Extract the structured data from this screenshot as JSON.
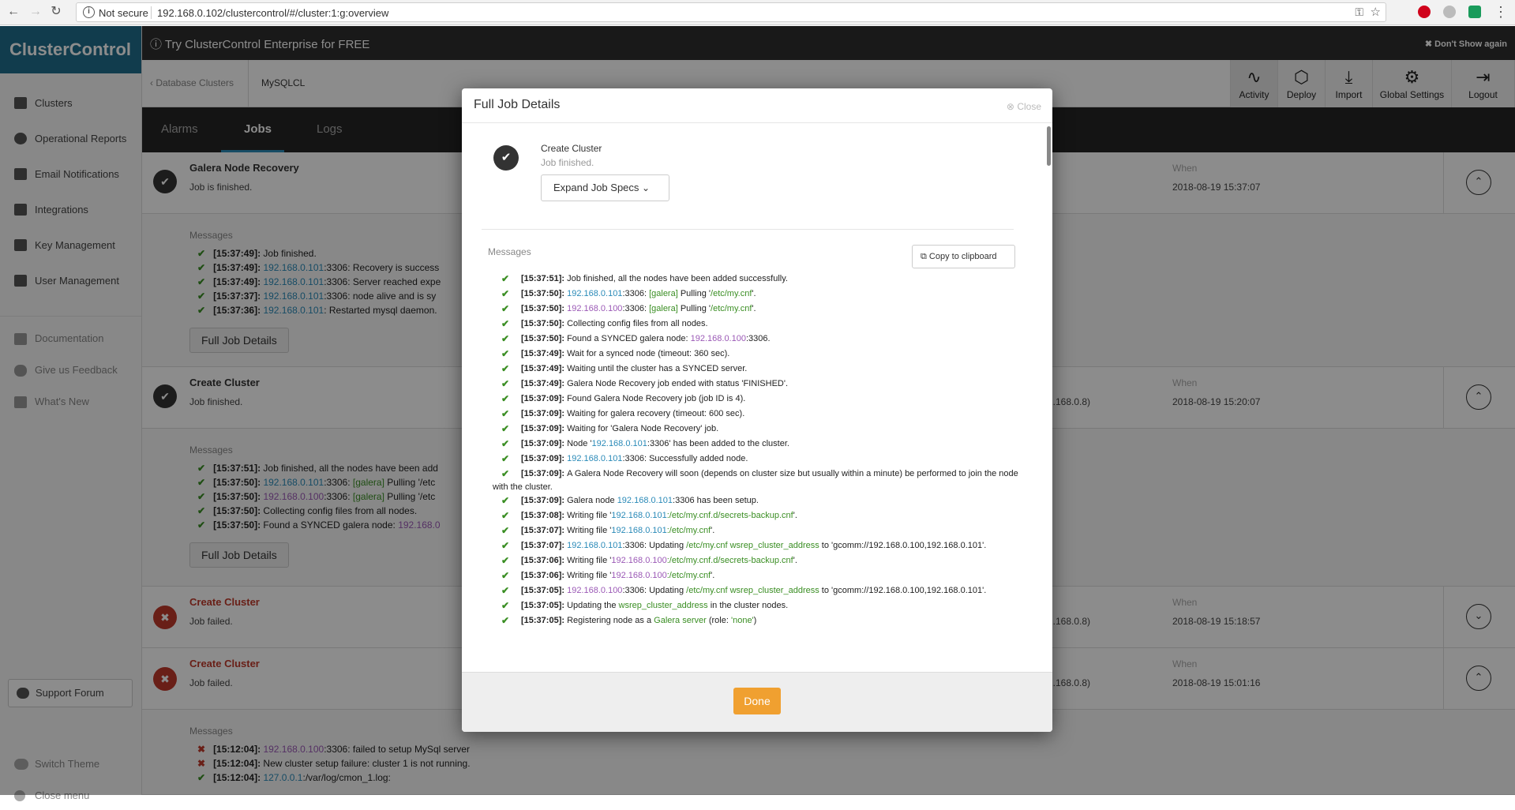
{
  "browser": {
    "not_secure": "Not secure",
    "url": "192.168.0.102/clustercontrol/#/cluster:1:g:overview"
  },
  "app": {
    "logo": "ClusterControl",
    "promo": "Try ClusterControl Enterprise for FREE",
    "dont_show": "✖ Don't Show again"
  },
  "sidebar": {
    "items": [
      {
        "label": "Clusters"
      },
      {
        "label": "Operational Reports"
      },
      {
        "label": "Email Notifications"
      },
      {
        "label": "Integrations"
      },
      {
        "label": "Key Management"
      },
      {
        "label": "User Management"
      }
    ],
    "secondary": [
      {
        "label": "Documentation"
      },
      {
        "label": "Give us Feedback"
      },
      {
        "label": "What's New"
      }
    ],
    "support_forum": "Support Forum",
    "switch_theme": "Switch Theme",
    "close_menu": "Close menu"
  },
  "breadcrumb": {
    "back": "‹ Database Clusters",
    "cluster": "MySQLCL"
  },
  "tools": [
    {
      "label": "Activity",
      "icon": "activity-icon"
    },
    {
      "label": "Deploy",
      "icon": "deploy-icon"
    },
    {
      "label": "Import",
      "icon": "import-icon"
    },
    {
      "label": "Global Settings",
      "icon": "settings-icon"
    },
    {
      "label": "Logout",
      "icon": "logout-icon"
    }
  ],
  "tabs": {
    "alarms": "Alarms",
    "jobs": "Jobs",
    "logs": "Logs"
  },
  "jobs": {
    "when_label": "When",
    "messages_label": "Messages",
    "full_job_details": "Full Job Details",
    "job1": {
      "title": "Galera Node Recovery",
      "status": "Job is finished.",
      "when": "2018-08-19 15:37:07"
    },
    "job1_msgs": [
      {
        "t": "[15:37:49]:",
        "a": " Job finished."
      },
      {
        "t": "[15:37:49]:",
        "h": "192.168.0.101",
        "a": ":3306: Recovery is success"
      },
      {
        "t": "[15:37:49]:",
        "h": "192.168.0.101",
        "a": ":3306: Server reached expe"
      },
      {
        "t": "[15:37:37]:",
        "h": "192.168.0.101",
        "a": ":3306: node alive and is sy"
      },
      {
        "t": "[15:37:36]:",
        "h": "192.168.0.101",
        "a": ": Restarted mysql daemon."
      }
    ],
    "job2": {
      "title": "Create Cluster",
      "status": "Job finished.",
      "host": "2.168.0.8)",
      "when": "2018-08-19 15:20:07"
    },
    "job2_msgs": [
      {
        "t": "[15:37:51]:",
        "a": " Job finished, all the nodes have been add"
      },
      {
        "t": "[15:37:50]:",
        "h": "192.168.0.101",
        "a": ":3306: ",
        "g": "[galera]",
        "b": " Pulling '/etc"
      },
      {
        "t": "[15:37:50]:",
        "p": "192.168.0.100",
        "a": ":3306: ",
        "g": "[galera]",
        "b": " Pulling '/etc"
      },
      {
        "t": "[15:37:50]:",
        "a": " Collecting config files from all nodes."
      },
      {
        "t": "[15:37:50]:",
        "a": " Found a SYNCED galera node: ",
        "p2": "192.168.0"
      }
    ],
    "job3": {
      "title": "Create Cluster",
      "status": "Job failed.",
      "host": "2.168.0.8)",
      "when": "2018-08-19 15:18:57"
    },
    "job4": {
      "title": "Create Cluster",
      "status": "Job failed.",
      "host": "2.168.0.8)",
      "when": "2018-08-19 15:01:16"
    },
    "job4_msgs": [
      {
        "t": "[15:12:04]:",
        "p": "192.168.0.100",
        "a": ":3306: failed to setup MySql server"
      },
      {
        "t": "[15:12:04]:",
        "a": " New cluster setup failure: cluster 1 is not running."
      },
      {
        "t": "[15:12:04]:",
        "h": "127.0.0.1",
        "a": ":/var/log/cmon_1.log:"
      }
    ]
  },
  "modal": {
    "title": "Full Job Details",
    "close": "Close",
    "job_title": "Create Cluster",
    "job_status": "Job finished.",
    "expand": "Expand Job Specs",
    "messages_label": "Messages",
    "copy": "Copy to clipboard",
    "done": "Done",
    "lines": [
      "[15:37:51]:|Job finished, all the nodes have been added successfully.",
      "[15:37:50]:|192.168.0.101|:3306: |[galera]| Pulling '|/etc/my.cnf|'.",
      "[15:37:50]:|192.168.0.100|:3306: |[galera]| Pulling '|/etc/my.cnf|'.",
      "[15:37:50]:|Collecting config files from all nodes.",
      "[15:37:50]:|Found a SYNCED galera node: |192.168.0.100|:3306.",
      "[15:37:49]:|Wait for a synced node (timeout: 360 sec).",
      "[15:37:49]:|Waiting until the cluster has a SYNCED server.",
      "[15:37:49]:|Galera Node Recovery job ended with status 'FINISHED'.",
      "[15:37:09]:|Found Galera Node Recovery job (job ID is 4).",
      "[15:37:09]:|Waiting for galera recovery (timeout: 600 sec).",
      "[15:37:09]:|Waiting for 'Galera Node Recovery' job.",
      "[15:37:09]:|Node '|192.168.0.101|:3306' has been added to the cluster.",
      "[15:37:09]:|192.168.0.101|:3306: Successfully added node.",
      "[15:37:09]:|A Galera Node Recovery will soon (depends on cluster size but usually within a minute) be performed to join the node with the cluster.",
      "[15:37:09]:|Galera node |192.168.0.101|:3306 has been setup.",
      "[15:37:08]:|Writing file '|192.168.0.101|:/etc/my.cnf.d/secrets-backup.cnf|'.",
      "[15:37:07]:|Writing file '|192.168.0.101|:/etc/my.cnf|'.",
      "[15:37:07]:|192.168.0.101|:3306: Updating |/etc/my.cnf| |wsrep_cluster_address| to 'gcomm://192.168.0.100,192.168.0.101'.",
      "[15:37:06]:|Writing file '|192.168.0.100|:/etc/my.cnf.d/secrets-backup.cnf|'.",
      "[15:37:06]:|Writing file '|192.168.0.100|:/etc/my.cnf|'.",
      "[15:37:05]:|192.168.0.100|:3306: Updating |/etc/my.cnf| |wsrep_cluster_address| to 'gcomm://192.168.0.100,192.168.0.101'.",
      "[15:37:05]:|Updating the |wsrep_cluster_address| in the cluster nodes.",
      "[15:37:05]:|Registering node as a |Galera server| (role: |'none'|)"
    ]
  }
}
